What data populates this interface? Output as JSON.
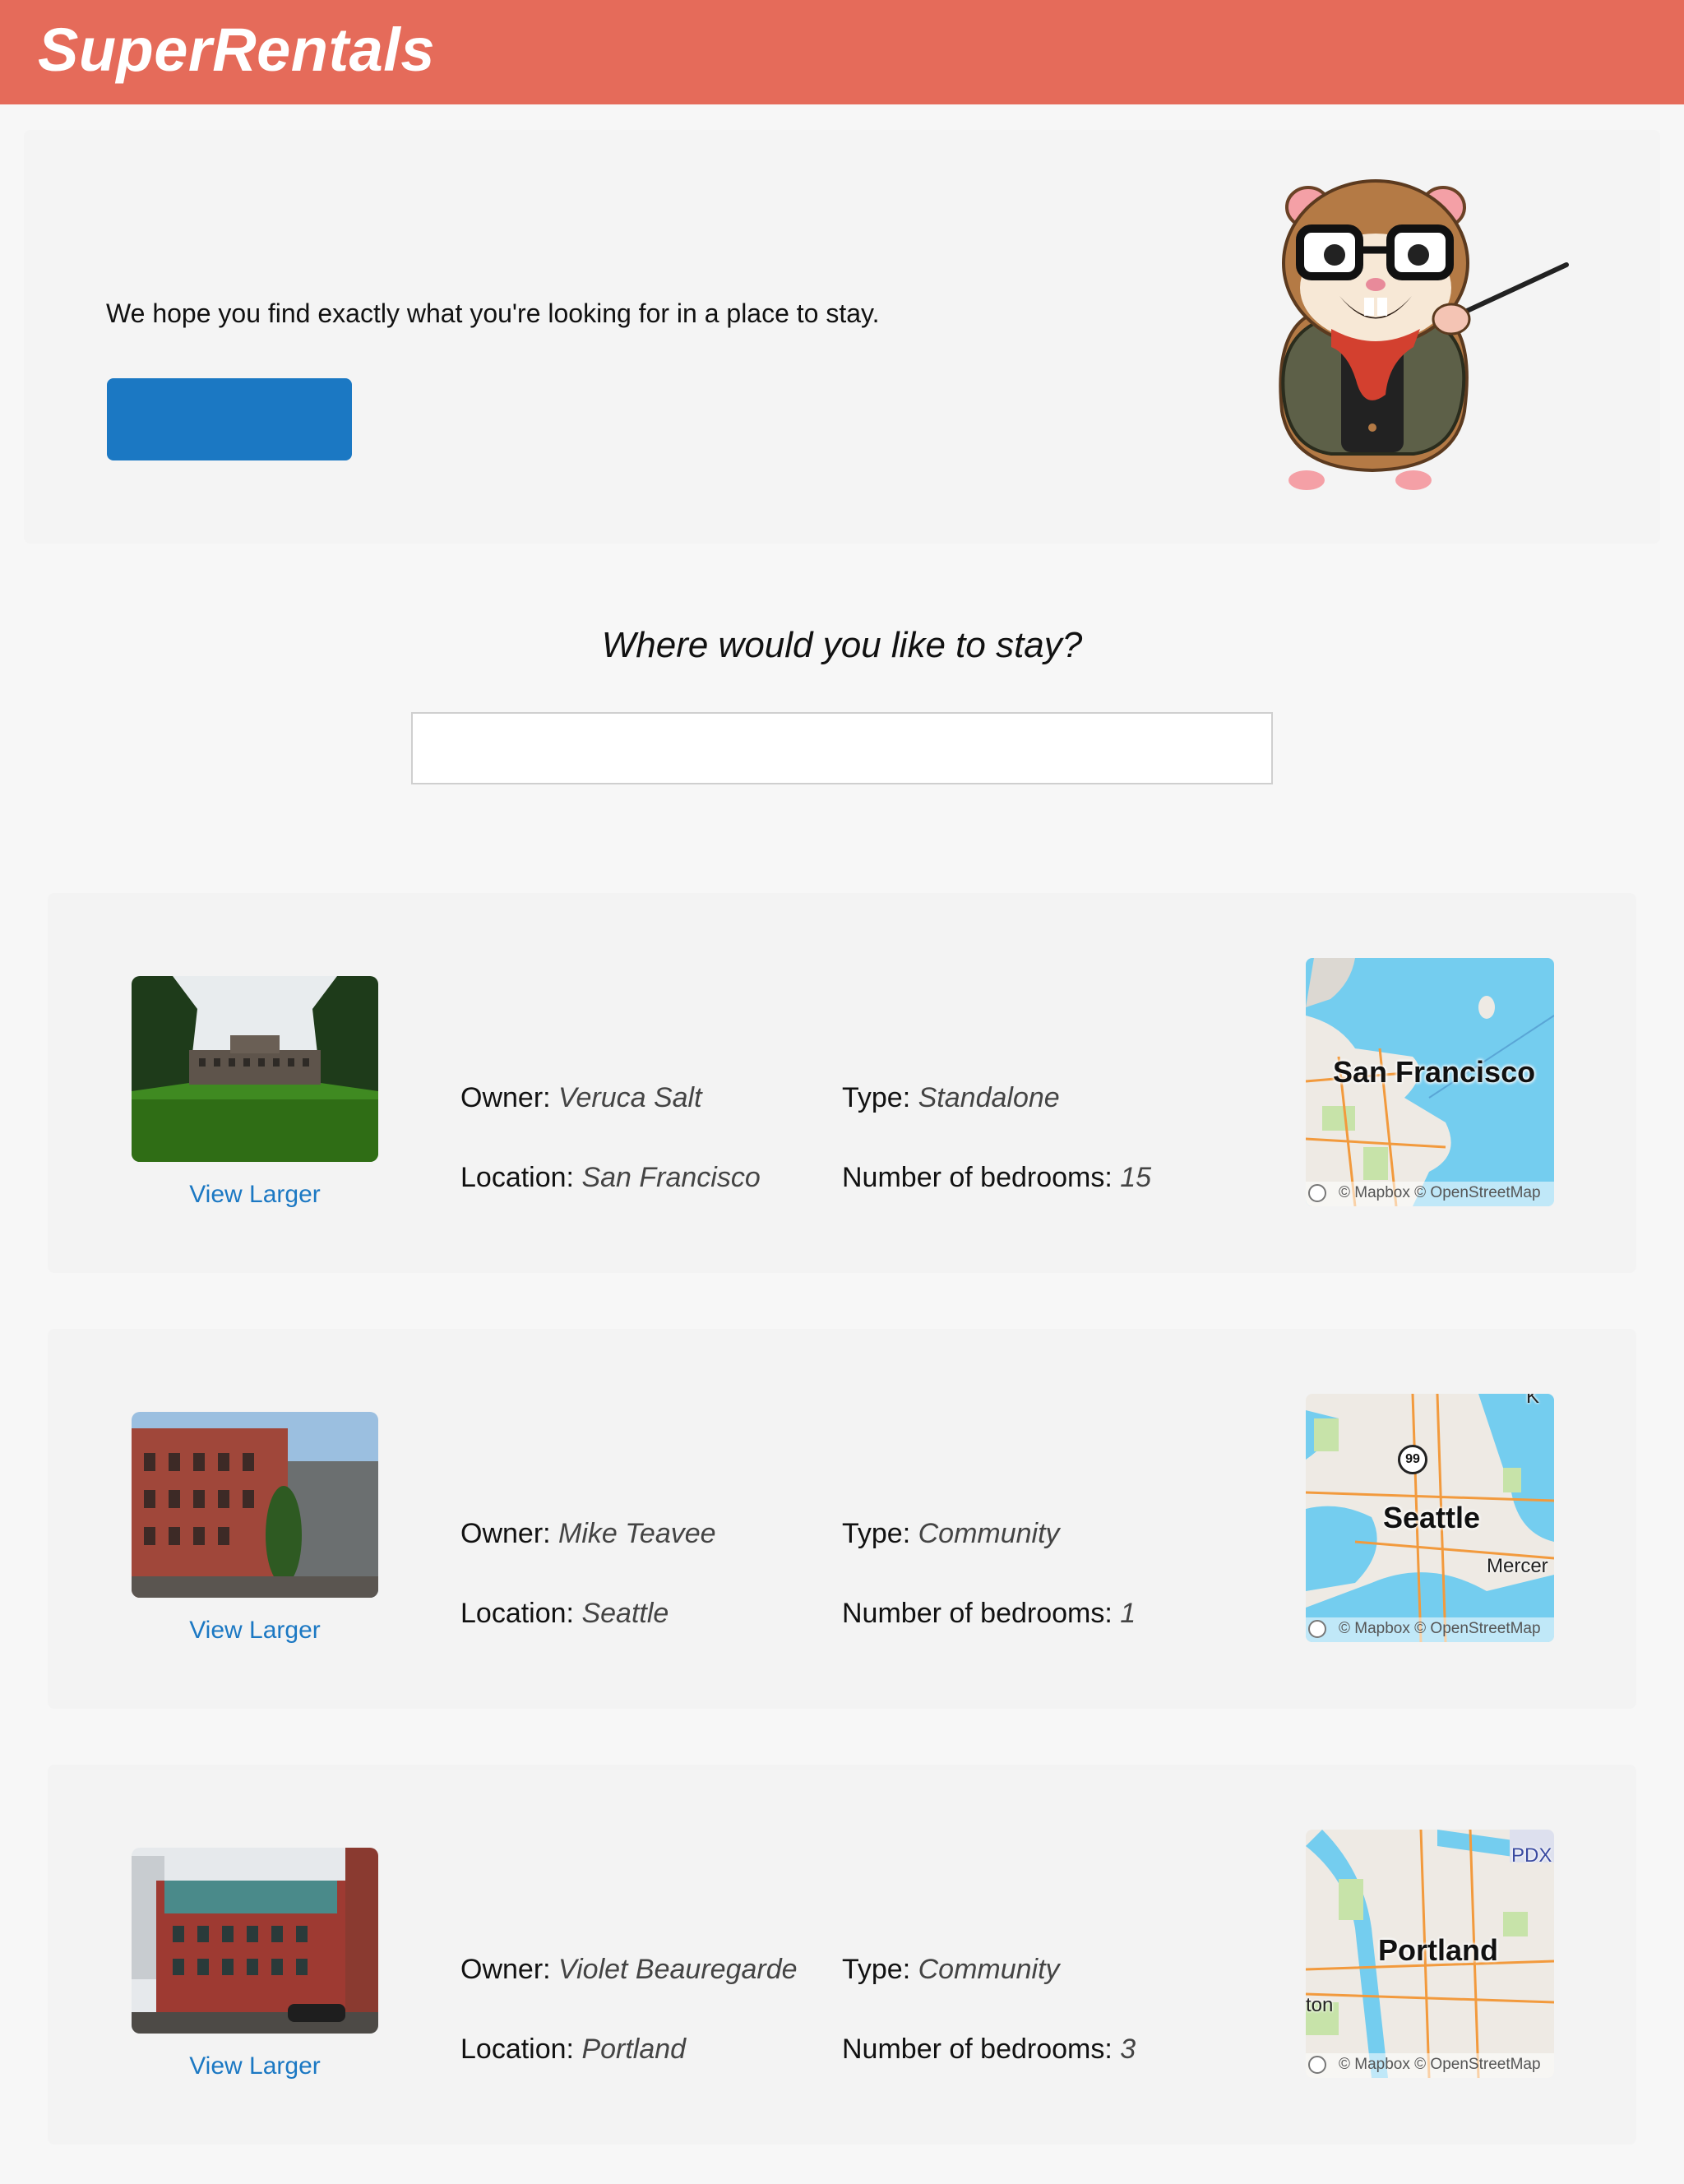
{
  "header": {
    "brand": "SuperRentals"
  },
  "hero": {
    "text": "We hope you find exactly what you're looking for in a place to stay.",
    "button_label": "",
    "mascot_icon": "tomster-hamster-teacher-icon"
  },
  "search": {
    "heading": "Where would you like to stay?",
    "value": "",
    "placeholder": ""
  },
  "labels": {
    "owner": "Owner:",
    "location": "Location:",
    "type": "Type:",
    "bedrooms": "Number of bedrooms:",
    "view_larger": "View Larger",
    "map_attribution": "© Mapbox © OpenStreetMap"
  },
  "rentals": [
    {
      "owner": "Veruca Salt",
      "location": "San Francisco",
      "type": "Standalone",
      "bedrooms": "15",
      "map_city": "San Francisco"
    },
    {
      "owner": "Mike Teavee",
      "location": "Seattle",
      "type": "Community",
      "bedrooms": "1",
      "map_city": "Seattle",
      "map_extra": "Mercer",
      "map_route": "99"
    },
    {
      "owner": "Violet Beauregarde",
      "location": "Portland",
      "type": "Community",
      "bedrooms": "3",
      "map_city": "Portland",
      "map_extra": "PDX",
      "map_extra2": "ton"
    }
  ],
  "colors": {
    "header_bg": "#e56b5a",
    "button_blue": "#1b78c3",
    "link_blue": "#1b78c3",
    "water": "#74cdef",
    "land": "#eeeae4",
    "park": "#c7e3a9",
    "road": "#f29a3d"
  }
}
